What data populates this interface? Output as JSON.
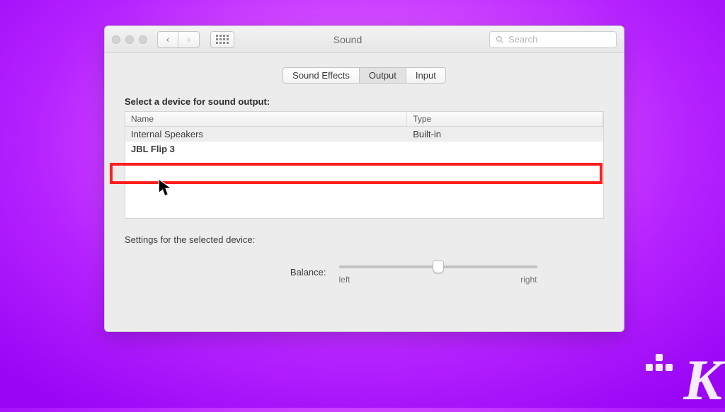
{
  "window": {
    "title": "Sound"
  },
  "search": {
    "placeholder": "Search"
  },
  "tabs": [
    {
      "label": "Sound Effects",
      "active": false
    },
    {
      "label": "Output",
      "active": true
    },
    {
      "label": "Input",
      "active": false
    }
  ],
  "select_label": "Select a device for sound output:",
  "columns": {
    "name": "Name",
    "type": "Type"
  },
  "devices": [
    {
      "name": "Internal Speakers",
      "type": "Built-in"
    },
    {
      "name": "JBL Flip 3",
      "type": ""
    }
  ],
  "settings_label": "Settings for the selected device:",
  "balance": {
    "label": "Balance:",
    "left": "left",
    "right": "right",
    "value": 50,
    "min": 0,
    "max": 100
  },
  "nav": {
    "back": "‹",
    "forward": "›"
  }
}
